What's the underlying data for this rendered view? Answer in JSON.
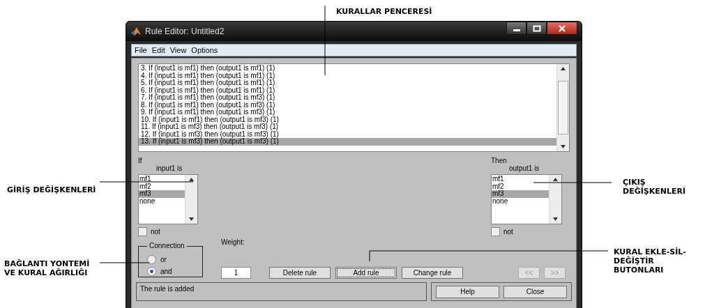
{
  "annotations": [
    {
      "text": "KURALLAR PENCERESİ"
    },
    {
      "text": "GİRİŞ DEĞİŞKENLERİ"
    },
    {
      "text": "ÇIKIŞ DEĞİŞKENLERİ"
    },
    {
      "text": "BAĞLANTI YONTEMİ VE KURAL AĞIRLIĞI"
    },
    {
      "text": "KURAL EKLE-SİL-DEĞİŞTİR BUTONLARI"
    }
  ],
  "window": {
    "title": "Rule Editor: Untitled2"
  },
  "menu": [
    "File",
    "Edit",
    "View",
    "Options"
  ],
  "rules": [
    {
      "text": "3. If (input1 is mf1) then (output1 is mf1) (1)",
      "selected": false
    },
    {
      "text": "4. If (input1 is mf1) then (output1 is mf1) (1)",
      "selected": false
    },
    {
      "text": "5. If (input1 is mf1) then (output1 is mf1) (1)",
      "selected": false
    },
    {
      "text": "6. If (input1 is mf1) then (output1 is mf1) (1)",
      "selected": false
    },
    {
      "text": "7. If (input1 is mf1) then (output1 is mf3) (1)",
      "selected": false
    },
    {
      "text": "8. If (input1 is mf1) then (output1 is mf3) (1)",
      "selected": false
    },
    {
      "text": "9. If (input1 is mf1) then (output1 is mf3) (1)",
      "selected": false
    },
    {
      "text": "10. If (input1 is mf1) then (output1 is mf3) (1)",
      "selected": false
    },
    {
      "text": "11. If (input1 is mf3) then (output1 is mf3) (1)",
      "selected": false
    },
    {
      "text": "12. If (input1 is mf3) then (output1 is mf3) (1)",
      "selected": false
    },
    {
      "text": "13. If (input1 is mf3) then (output1 is mf3) (1)",
      "selected": true
    }
  ],
  "variables": [
    {
      "heading": "If",
      "label": "input1 is",
      "items": [
        {
          "label": "mf1",
          "selected": false
        },
        {
          "label": "mf2",
          "selected": false
        },
        {
          "label": "mf3",
          "selected": true
        },
        {
          "label": "none",
          "selected": false
        }
      ],
      "not": {
        "label": "not",
        "checked": false
      }
    },
    {
      "heading": "Then",
      "label": "output1 is",
      "items": [
        {
          "label": "mf1",
          "selected": false
        },
        {
          "label": "mf2",
          "selected": false
        },
        {
          "label": "mf3",
          "selected": true
        },
        {
          "label": "none",
          "selected": false
        }
      ],
      "not": {
        "label": "not",
        "checked": false
      }
    }
  ],
  "connection": {
    "title": "Connection",
    "options": [
      {
        "label": "or",
        "selected": false
      },
      {
        "label": "and",
        "selected": true
      }
    ]
  },
  "weight": {
    "label": "Weight:",
    "value": "1"
  },
  "rule_buttons": [
    {
      "label": "Delete rule",
      "focused": false
    },
    {
      "label": "Add rule",
      "focused": true
    },
    {
      "label": "Change rule",
      "focused": false
    }
  ],
  "nav_buttons": [
    {
      "label": "<<",
      "disabled": true
    },
    {
      "label": ">>",
      "disabled": true
    }
  ],
  "status": "The rule is added",
  "dialog_buttons": [
    {
      "label": "Help"
    },
    {
      "label": "Close"
    }
  ]
}
